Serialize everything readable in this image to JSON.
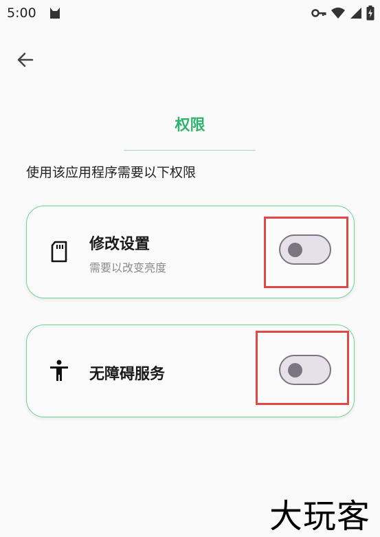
{
  "status_bar": {
    "time": "5:00",
    "icons": [
      "cat-icon",
      "key-icon",
      "wifi-icon",
      "signal-icon",
      "battery-charging-icon"
    ]
  },
  "nav": {
    "back_icon": "arrow-left-icon"
  },
  "header": {
    "title": "权限"
  },
  "subtitle": "使用该应用程序需要以下权限",
  "permissions": [
    {
      "icon": "sd-card-icon",
      "title": "修改设置",
      "subtitle": "需要以改变亮度",
      "enabled": false
    },
    {
      "icon": "accessibility-icon",
      "title": "无障碍服务",
      "enabled": false
    }
  ],
  "watermark": "大玩客",
  "colors": {
    "accent": "#2fb36e",
    "card_border": "#6fd48f",
    "highlight": "#e04848",
    "toggle": "#7a7580"
  }
}
